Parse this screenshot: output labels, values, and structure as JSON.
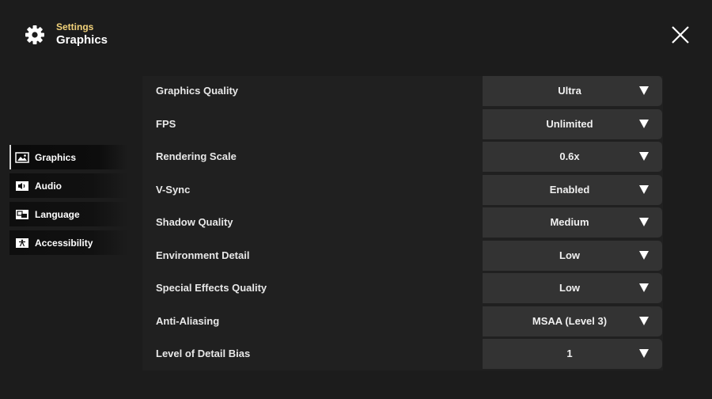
{
  "header": {
    "crumb": "Settings",
    "title": "Graphics",
    "icon": "gear-icon",
    "close_icon": "close-icon"
  },
  "sidebar": {
    "items": [
      {
        "label": "Graphics",
        "icon": "image-icon",
        "active": true
      },
      {
        "label": "Audio",
        "icon": "speaker-icon",
        "active": false
      },
      {
        "label": "Language",
        "icon": "translate-icon",
        "active": false
      },
      {
        "label": "Accessibility",
        "icon": "accessibility-icon",
        "active": false
      }
    ]
  },
  "settings": [
    {
      "label": "Graphics Quality",
      "value": "Ultra"
    },
    {
      "label": "FPS",
      "value": "Unlimited"
    },
    {
      "label": "Rendering Scale",
      "value": "0.6x"
    },
    {
      "label": "V-Sync",
      "value": "Enabled"
    },
    {
      "label": "Shadow Quality",
      "value": "Medium"
    },
    {
      "label": "Environment Detail",
      "value": "Low"
    },
    {
      "label": "Special Effects Quality",
      "value": "Low"
    },
    {
      "label": "Anti-Aliasing",
      "value": "MSAA (Level 3)"
    },
    {
      "label": "Level of Detail Bias",
      "value": "1"
    }
  ],
  "colors": {
    "background": "#1c1c1c",
    "accent": "#f2d27a",
    "dropdown": "#333333",
    "panel": "#202020"
  }
}
